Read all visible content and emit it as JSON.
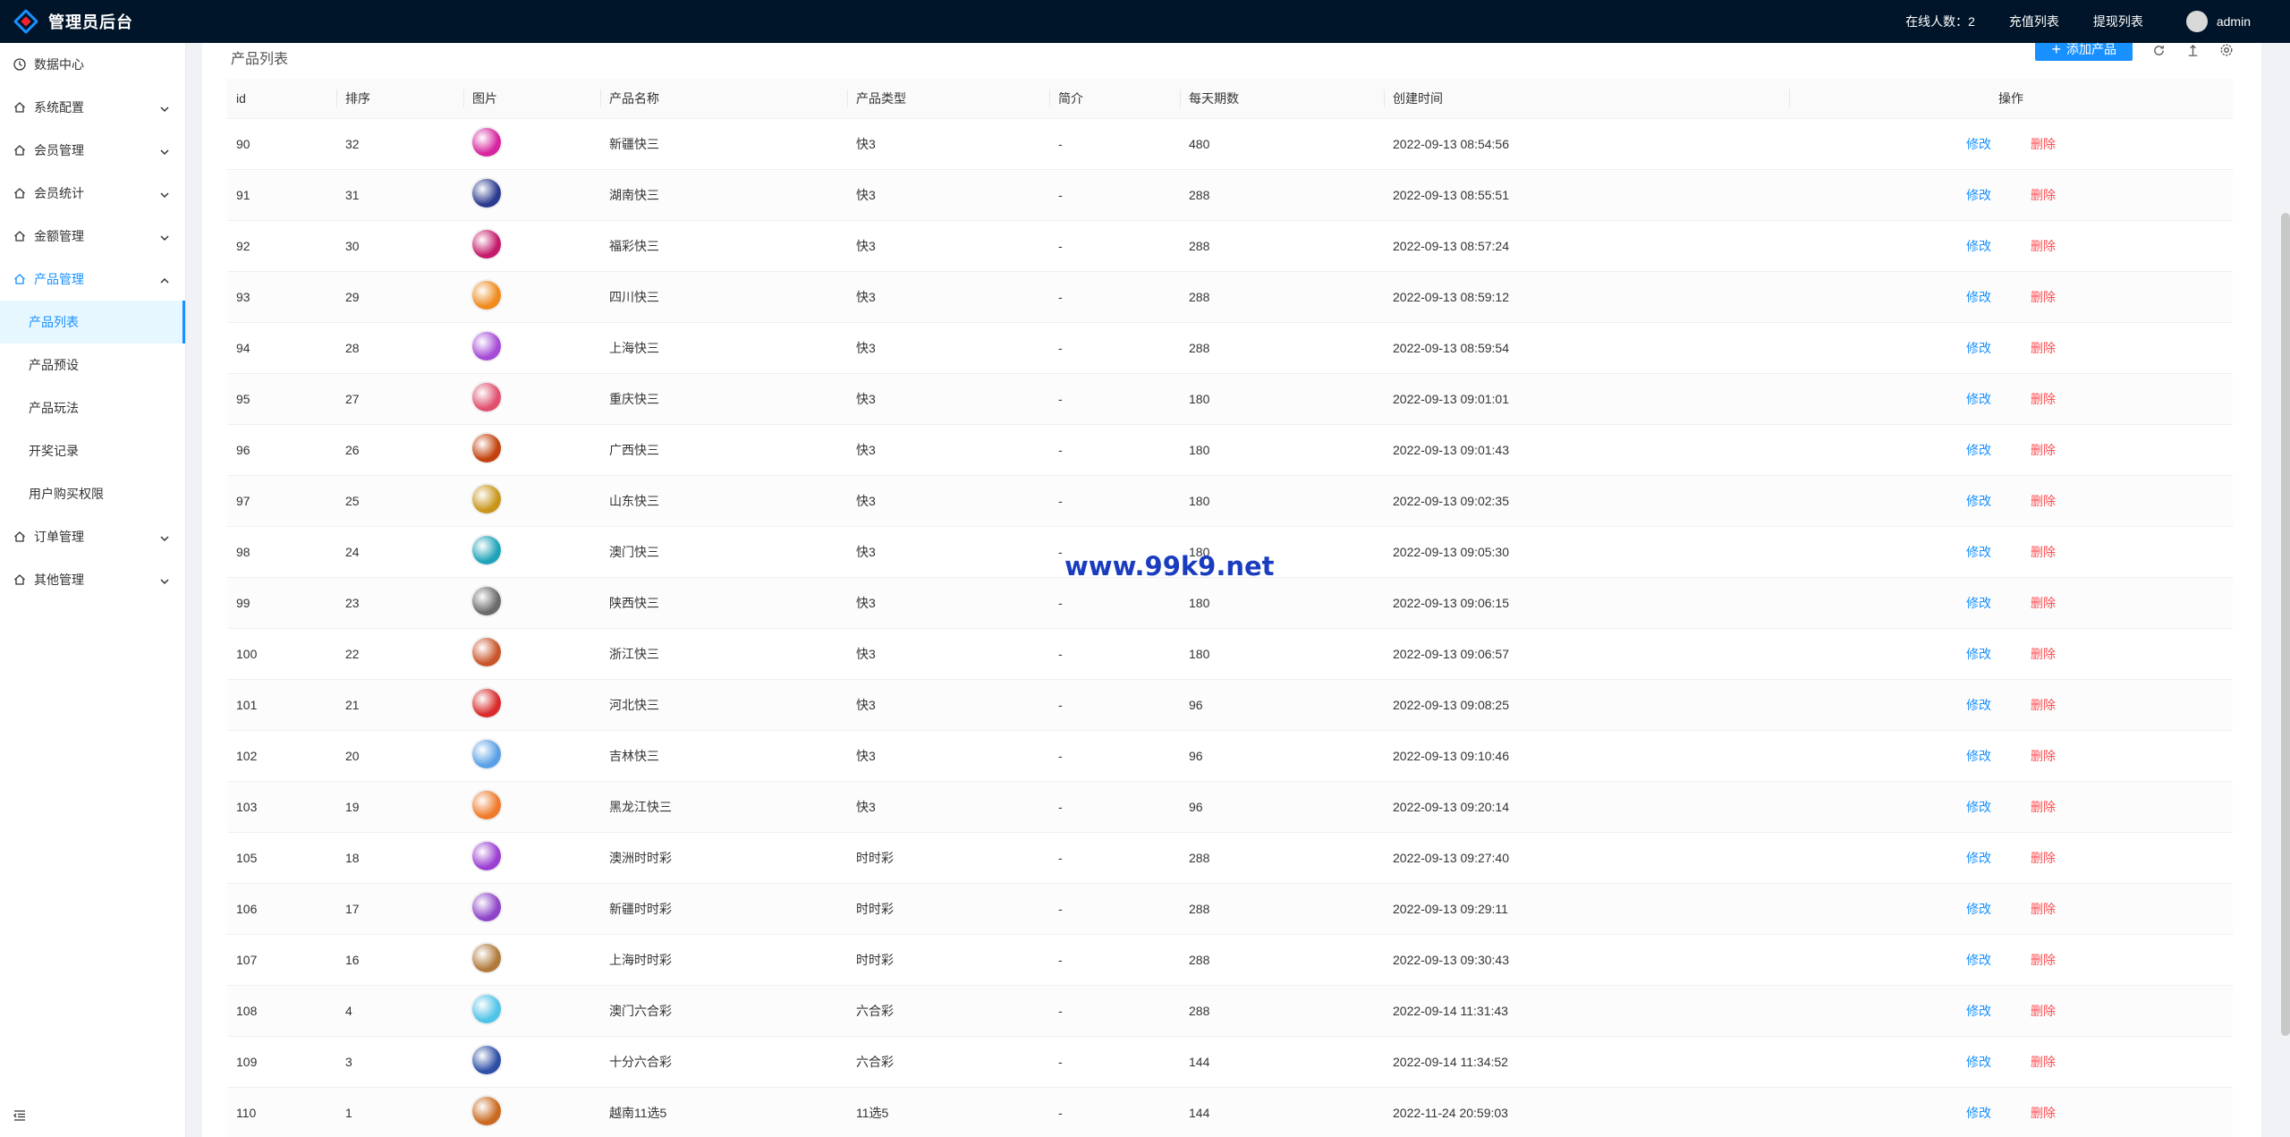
{
  "header": {
    "title": "管理员后台",
    "online_label": "在线人数：",
    "online_count": "2",
    "recharge_list": "充值列表",
    "withdraw_list": "提现列表",
    "username": "admin"
  },
  "sidebar": {
    "items": [
      {
        "label": "数据中心"
      },
      {
        "label": "系统配置"
      },
      {
        "label": "会员管理"
      },
      {
        "label": "会员统计"
      },
      {
        "label": "金额管理"
      },
      {
        "label": "产品管理"
      },
      {
        "label": "订单管理"
      },
      {
        "label": "其他管理"
      }
    ],
    "sub_items": [
      {
        "label": "产品列表"
      },
      {
        "label": "产品预设"
      },
      {
        "label": "产品玩法"
      },
      {
        "label": "开奖记录"
      },
      {
        "label": "用户购买权限"
      }
    ]
  },
  "page": {
    "title": "产品列表",
    "add_button": "添加产品"
  },
  "table": {
    "columns": [
      "id",
      "排序",
      "图片",
      "产品名称",
      "产品类型",
      "简介",
      "每天期数",
      "创建时间",
      "操作"
    ],
    "edit_label": "修改",
    "delete_label": "删除",
    "rows": [
      {
        "id": "90",
        "sort": "32",
        "name": "新疆快三",
        "type": "快3",
        "intro": "-",
        "periods": "480",
        "created": "2022-09-13 08:54:56",
        "color": "#d6249f"
      },
      {
        "id": "91",
        "sort": "31",
        "name": "湖南快三",
        "type": "快3",
        "intro": "-",
        "periods": "288",
        "created": "2022-09-13 08:55:51",
        "color": "#2b3a8f"
      },
      {
        "id": "92",
        "sort": "30",
        "name": "福彩快三",
        "type": "快3",
        "intro": "-",
        "periods": "288",
        "created": "2022-09-13 08:57:24",
        "color": "#c41a6b"
      },
      {
        "id": "93",
        "sort": "29",
        "name": "四川快三",
        "type": "快3",
        "intro": "-",
        "periods": "288",
        "created": "2022-09-13 08:59:12",
        "color": "#f08a1c"
      },
      {
        "id": "94",
        "sort": "28",
        "name": "上海快三",
        "type": "快3",
        "intro": "-",
        "periods": "288",
        "created": "2022-09-13 08:59:54",
        "color": "#a64bd6"
      },
      {
        "id": "95",
        "sort": "27",
        "name": "重庆快三",
        "type": "快3",
        "intro": "-",
        "periods": "180",
        "created": "2022-09-13 09:01:01",
        "color": "#e0506e"
      },
      {
        "id": "96",
        "sort": "26",
        "name": "广西快三",
        "type": "快3",
        "intro": "-",
        "periods": "180",
        "created": "2022-09-13 09:01:43",
        "color": "#c2410c"
      },
      {
        "id": "97",
        "sort": "25",
        "name": "山东快三",
        "type": "快3",
        "intro": "-",
        "periods": "180",
        "created": "2022-09-13 09:02:35",
        "color": "#c8961a"
      },
      {
        "id": "98",
        "sort": "24",
        "name": "澳门快三",
        "type": "快3",
        "intro": "-",
        "periods": "180",
        "created": "2022-09-13 09:05:30",
        "color": "#1fa3b8"
      },
      {
        "id": "99",
        "sort": "23",
        "name": "陕西快三",
        "type": "快3",
        "intro": "-",
        "periods": "180",
        "created": "2022-09-13 09:06:15",
        "color": "#6b6b6b"
      },
      {
        "id": "100",
        "sort": "22",
        "name": "浙江快三",
        "type": "快3",
        "intro": "-",
        "periods": "180",
        "created": "2022-09-13 09:06:57",
        "color": "#c9552a"
      },
      {
        "id": "101",
        "sort": "21",
        "name": "河北快三",
        "type": "快3",
        "intro": "-",
        "periods": "96",
        "created": "2022-09-13 09:08:25",
        "color": "#d92b2b"
      },
      {
        "id": "102",
        "sort": "20",
        "name": "吉林快三",
        "type": "快3",
        "intro": "-",
        "periods": "96",
        "created": "2022-09-13 09:10:46",
        "color": "#5aa0e6"
      },
      {
        "id": "103",
        "sort": "19",
        "name": "黑龙江快三",
        "type": "快3",
        "intro": "-",
        "periods": "96",
        "created": "2022-09-13 09:20:14",
        "color": "#ef7a2a"
      },
      {
        "id": "105",
        "sort": "18",
        "name": "澳洲时时彩",
        "type": "时时彩",
        "intro": "-",
        "periods": "288",
        "created": "2022-09-13 09:27:40",
        "color": "#9b3fd1"
      },
      {
        "id": "106",
        "sort": "17",
        "name": "新疆时时彩",
        "type": "时时彩",
        "intro": "-",
        "periods": "288",
        "created": "2022-09-13 09:29:11",
        "color": "#8e44c9"
      },
      {
        "id": "107",
        "sort": "16",
        "name": "上海时时彩",
        "type": "时时彩",
        "intro": "-",
        "periods": "288",
        "created": "2022-09-13 09:30:43",
        "color": "#b07a3c"
      },
      {
        "id": "108",
        "sort": "4",
        "name": "澳门六合彩",
        "type": "六合彩",
        "intro": "-",
        "periods": "288",
        "created": "2022-09-14 11:31:43",
        "color": "#4fc3e8"
      },
      {
        "id": "109",
        "sort": "3",
        "name": "十分六合彩",
        "type": "六合彩",
        "intro": "-",
        "periods": "144",
        "created": "2022-09-14 11:34:52",
        "color": "#2d4fa6"
      },
      {
        "id": "110",
        "sort": "1",
        "name": "越南11选5",
        "type": "11选5",
        "intro": "-",
        "periods": "144",
        "created": "2022-11-24 20:59:03",
        "color": "#c9691f"
      }
    ]
  },
  "watermark": "www.99k9.net",
  "colors": {
    "header_bg": "#001529",
    "accent": "#1890ff",
    "danger": "#ff4d4f"
  }
}
